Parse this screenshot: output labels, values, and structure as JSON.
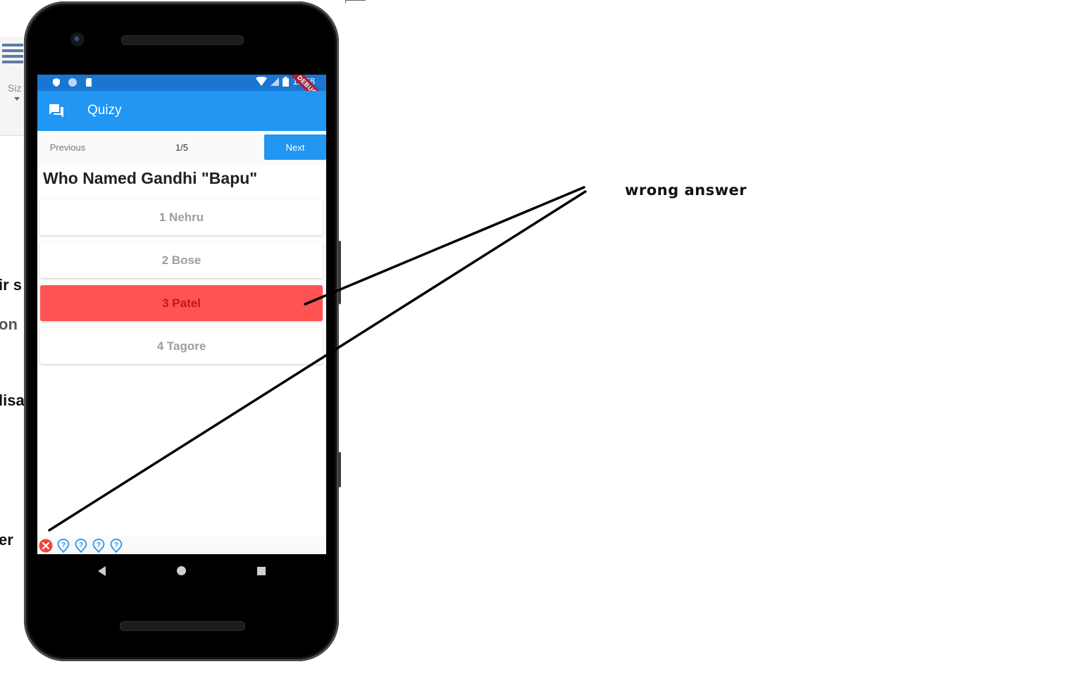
{
  "background_app": {
    "size_label": "Siz",
    "fragments": [
      "ir s",
      "on",
      "lisa",
      "er"
    ]
  },
  "status_bar": {
    "time": "11:58",
    "debug_banner": "DEBUG",
    "left_icons": [
      "shield-icon",
      "circle-icon",
      "sd-card-icon"
    ],
    "right_icons": [
      "wifi-icon",
      "signal-icon",
      "battery-icon"
    ]
  },
  "app_bar": {
    "title": "Quizy",
    "icon": "forum-icon",
    "color": "#2196f3"
  },
  "quiz_nav": {
    "previous_label": "Previous",
    "counter": "1/5",
    "next_label": "Next"
  },
  "question": {
    "text": "Who Named Gandhi \"Bapu\""
  },
  "options": [
    {
      "label": "1 Nehru",
      "state": "default"
    },
    {
      "label": "2 Bose",
      "state": "default"
    },
    {
      "label": "3 Patel",
      "state": "wrong"
    },
    {
      "label": "4 Tagore",
      "state": "default"
    }
  ],
  "progress_tracker": {
    "marks": [
      {
        "icon": "wrong-cross-icon",
        "state": "wrong",
        "color": "#f44336"
      },
      {
        "icon": "unanswered-help-icon",
        "state": "unanswered",
        "color": "#2196f3"
      },
      {
        "icon": "unanswered-help-icon",
        "state": "unanswered",
        "color": "#2196f3"
      },
      {
        "icon": "unanswered-help-icon",
        "state": "unanswered",
        "color": "#2196f3"
      },
      {
        "icon": "unanswered-help-icon",
        "state": "unanswered",
        "color": "#2196f3"
      }
    ]
  },
  "colors": {
    "wrong_answer_bg": "#ff5252",
    "primary": "#2196f3",
    "status_bar": "#1976d2"
  },
  "annotation": {
    "label": "wrong answer"
  }
}
